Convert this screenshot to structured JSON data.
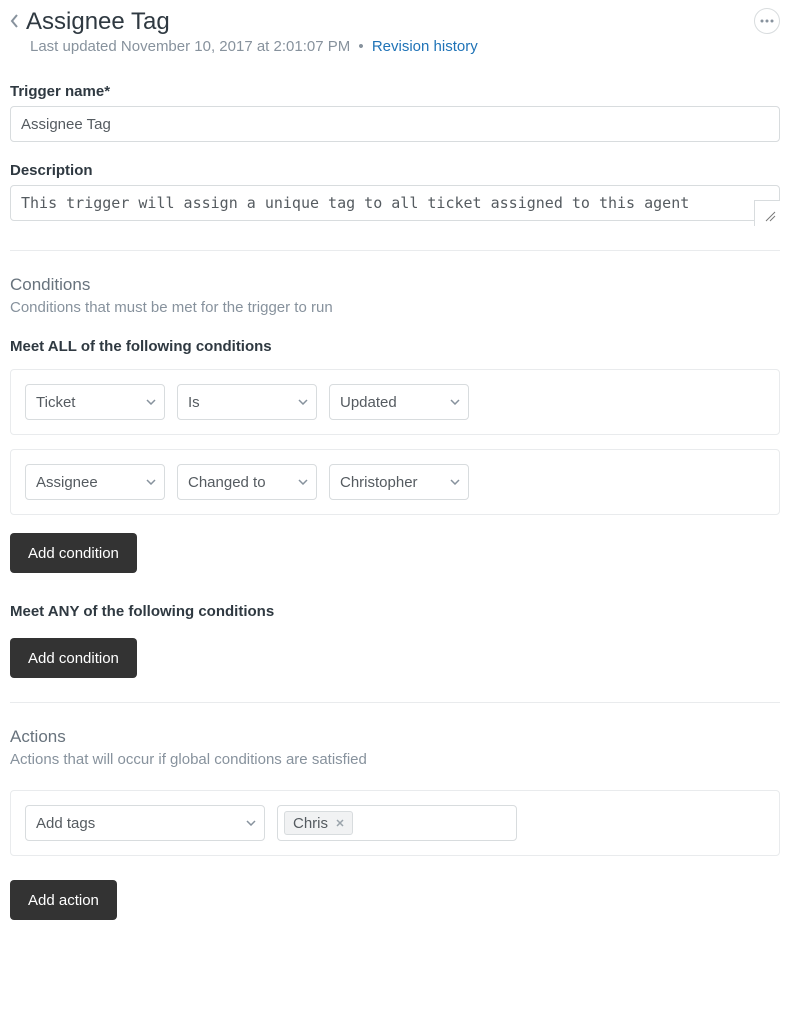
{
  "header": {
    "title": "Assignee Tag",
    "last_updated_prefix": "Last updated ",
    "last_updated": "November 10, 2017 at 2:01:07 PM",
    "revision_link": "Revision history"
  },
  "form": {
    "trigger_name_label": "Trigger name*",
    "trigger_name_value": "Assignee Tag",
    "description_label": "Description",
    "description_value": "This trigger will assign a unique tag to all ticket assigned to this agent"
  },
  "conditions": {
    "heading": "Conditions",
    "subtext": "Conditions that must be met for the trigger to run",
    "all_title": "Meet ALL of the following conditions",
    "any_title": "Meet ANY of the following conditions",
    "add_button": "Add condition",
    "rows_all": [
      {
        "field": "Ticket",
        "operator": "Is",
        "value": "Updated"
      },
      {
        "field": "Assignee",
        "operator": "Changed to",
        "value": "Christopher"
      }
    ],
    "rows_any": []
  },
  "actions": {
    "heading": "Actions",
    "subtext": "Actions that will occur if global conditions are satisfied",
    "add_button": "Add action",
    "rows": [
      {
        "field": "Add tags",
        "tags": [
          "Chris"
        ]
      }
    ]
  }
}
